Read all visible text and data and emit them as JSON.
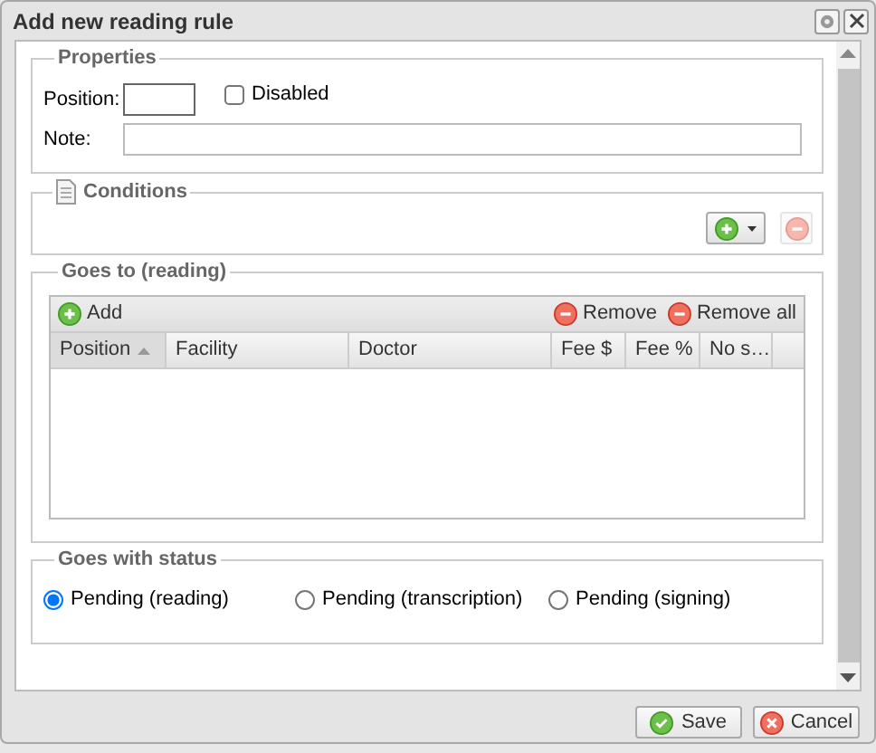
{
  "window": {
    "title": "Add new reading rule"
  },
  "properties": {
    "legend": "Properties",
    "position": {
      "label": "Position:",
      "focused": true
    },
    "disabled": {
      "label": "Disabled",
      "checked": false
    },
    "note": {
      "label": "Note:"
    }
  },
  "conditions": {
    "legend": "Conditions",
    "remove_disabled": true
  },
  "goes_to": {
    "legend": "Goes to (reading)",
    "toolbar": {
      "add": "Add",
      "remove": "Remove",
      "remove_all": "Remove all"
    },
    "columns": [
      {
        "label": "Position",
        "sorted": true
      },
      {
        "label": "Facility",
        "sorted": false
      },
      {
        "label": "Doctor",
        "sorted": false
      },
      {
        "label": "Fee $",
        "sorted": false
      },
      {
        "label": "Fee %",
        "sorted": false
      },
      {
        "label": "No s…",
        "sorted": false
      }
    ]
  },
  "status": {
    "legend": "Goes with status",
    "options": [
      {
        "label": "Pending (reading)",
        "selected": true
      },
      {
        "label": "Pending (transcription)",
        "selected": false
      },
      {
        "label": "Pending (signing)",
        "selected": false
      }
    ]
  },
  "buttons": [
    {
      "label": "Save",
      "kind": "save"
    },
    {
      "label": "Cancel",
      "kind": "cancel"
    }
  ]
}
